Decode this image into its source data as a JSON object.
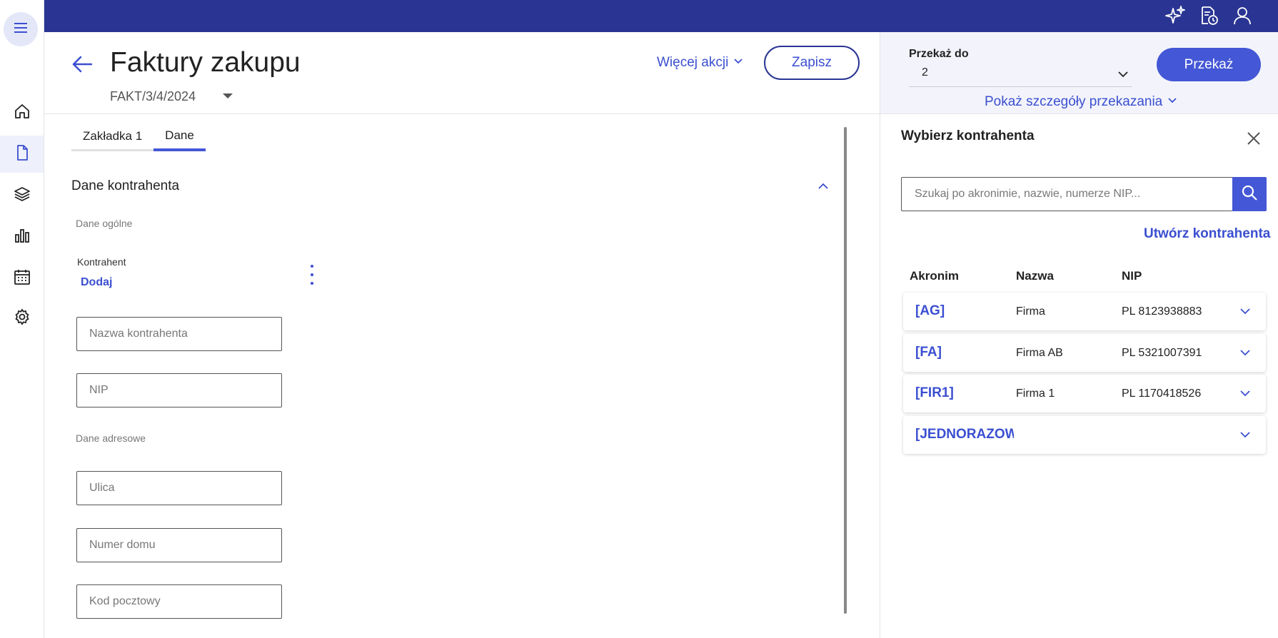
{
  "header": {
    "title": "Faktury zakupu",
    "doc_number": "FAKT/3/4/2024",
    "more_actions": "Więcej akcji",
    "save": "Zapisz"
  },
  "transfer": {
    "label": "Przekaż do",
    "value": "2",
    "button": "Przekaż",
    "details_link": "Pokaż szczegóły przekazania"
  },
  "tabs": [
    {
      "label": "Zakładka 1",
      "active": false
    },
    {
      "label": "Dane",
      "active": true
    }
  ],
  "form": {
    "section_title": "Dane kontrahenta",
    "general_heading": "Dane ogólne",
    "contractor_label": "Kontrahent",
    "add_link": "Dodaj",
    "name_placeholder": "Nazwa kontrahenta",
    "nip_placeholder": "NIP",
    "address_heading": "Dane adresowe",
    "street_placeholder": "Ulica",
    "house_placeholder": "Numer domu",
    "postal_placeholder": "Kod pocztowy"
  },
  "panel": {
    "title": "Wybierz kontrahenta",
    "search_placeholder": "Szukaj po akronimie, nazwie, numerze NIP...",
    "create_link": "Utwórz kontrahenta",
    "columns": [
      "Akronim",
      "Nazwa",
      "NIP"
    ],
    "rows": [
      {
        "acronym": "[AG]",
        "name": "Firma",
        "nip": "PL 8123938883"
      },
      {
        "acronym": "[FA]",
        "name": "Firma AB",
        "nip": "PL 5321007391"
      },
      {
        "acronym": "[FIR1]",
        "name": "Firma 1",
        "nip": "PL 1170418526"
      },
      {
        "acronym": "[JEDNORAZOWY]",
        "name": "",
        "nip": ""
      }
    ]
  },
  "icons": {
    "topbar": [
      "sparkles-icon",
      "document-clock-icon",
      "user-icon"
    ],
    "sidenav": [
      "menu-icon",
      "home-icon",
      "document-icon",
      "layers-icon",
      "bar-chart-icon",
      "calendar-icon",
      "gear-icon"
    ]
  },
  "colors": {
    "topbar": "#2a3593",
    "accent": "#4457d6",
    "link": "#3b4fd0"
  }
}
